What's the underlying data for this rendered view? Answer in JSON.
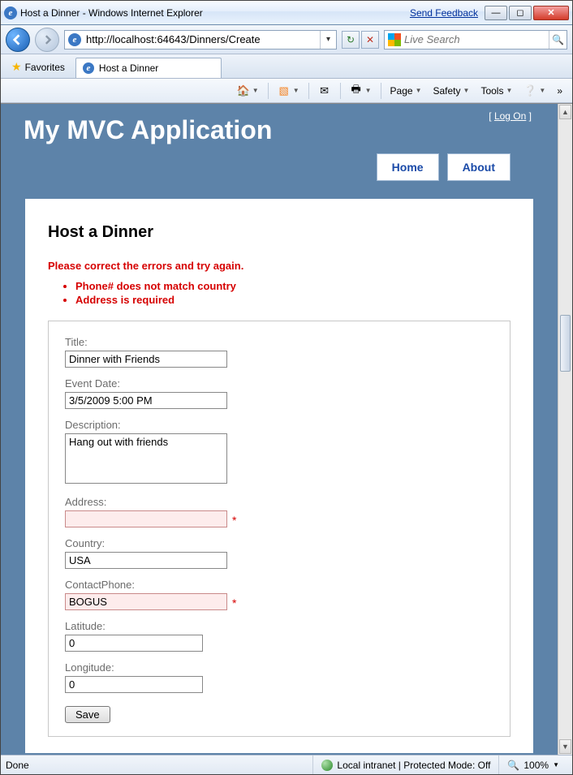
{
  "window": {
    "title": "Host a Dinner - Windows Internet Explorer",
    "feedback": "Send Feedback"
  },
  "address": {
    "url": "http://localhost:64643/Dinners/Create"
  },
  "search": {
    "placeholder": "Live Search"
  },
  "favorites": "Favorites",
  "tab": {
    "title": "Host a Dinner"
  },
  "commandbar": {
    "page": "Page",
    "safety": "Safety",
    "tools": "Tools"
  },
  "app": {
    "title": "My MVC Application",
    "logon": "Log On",
    "nav": {
      "home": "Home",
      "about": "About"
    }
  },
  "page": {
    "heading": "Host a Dinner",
    "summary": "Please correct the errors and try again.",
    "errors": [
      "Phone# does not match country",
      "Address is required"
    ],
    "fields": {
      "title": {
        "label": "Title:",
        "value": "Dinner with Friends"
      },
      "eventdate": {
        "label": "Event Date:",
        "value": "3/5/2009 5:00 PM"
      },
      "description": {
        "label": "Description:",
        "value": "Hang out with friends"
      },
      "address": {
        "label": "Address:",
        "value": "",
        "star": "*"
      },
      "country": {
        "label": "Country:",
        "value": "USA"
      },
      "contactphone": {
        "label": "ContactPhone:",
        "value": "BOGUS",
        "star": "*"
      },
      "latitude": {
        "label": "Latitude:",
        "value": "0"
      },
      "longitude": {
        "label": "Longitude:",
        "value": "0"
      }
    },
    "save": "Save"
  },
  "status": {
    "left": "Done",
    "zone": "Local intranet | Protected Mode: Off",
    "zoom": "100%"
  }
}
